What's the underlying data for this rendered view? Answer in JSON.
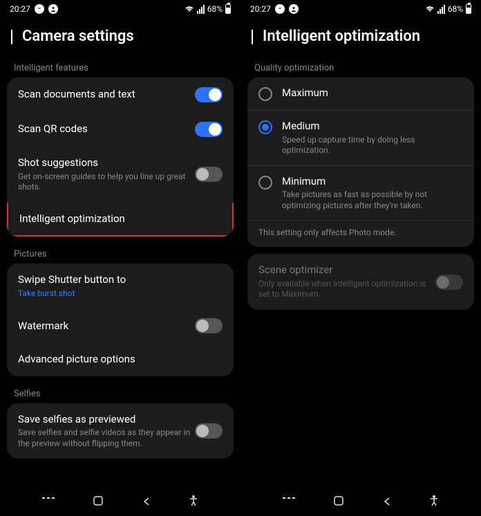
{
  "status": {
    "time": "20:27",
    "battery": "68%"
  },
  "left": {
    "title": "Camera settings",
    "sections": {
      "intelligent": {
        "label": "Intelligent features",
        "scan_docs": "Scan documents and text",
        "scan_qr": "Scan QR codes",
        "shot_suggestions_title": "Shot suggestions",
        "shot_suggestions_sub": "Get on-screen guides to help you line up great shots.",
        "intelligent_opt": "Intelligent optimization"
      },
      "pictures": {
        "label": "Pictures",
        "swipe_title": "Swipe Shutter button to",
        "swipe_sub": "Take burst shot",
        "watermark": "Watermark",
        "advanced": "Advanced picture options"
      },
      "selfies": {
        "label": "Selfies",
        "save_title": "Save selfies as previewed",
        "save_sub": "Save selfies and selfie videos as they appear in the preview without flipping them."
      }
    }
  },
  "right": {
    "title": "Intelligent optimization",
    "quality_label": "Quality optimization",
    "options": {
      "maximum": "Maximum",
      "medium_title": "Medium",
      "medium_sub": "Speed up capture time by doing less optimization.",
      "minimum_title": "Minimum",
      "minimum_sub": "Take pictures as fast as possible by not optimizing pictures after they're taken."
    },
    "note": "This setting only affects Photo mode.",
    "scene_title": "Scene optimizer",
    "scene_sub": "Only available when Intelligent optimization is set to Maximum."
  }
}
